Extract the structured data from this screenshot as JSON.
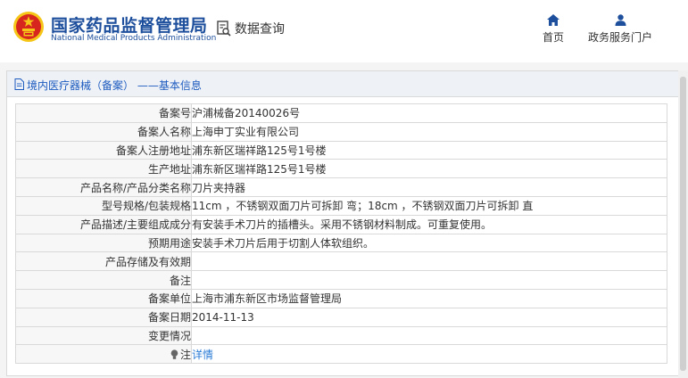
{
  "header": {
    "site_title": "国家药品监督管理局",
    "site_subtitle": "National Medical Products Administration",
    "data_query_label": "数据查询",
    "nav": [
      {
        "label": "首页",
        "icon": "home-icon"
      },
      {
        "label": "政务服务门户",
        "icon": "user-icon"
      }
    ]
  },
  "panel": {
    "title": "境内医疗器械（备案）  ——基本信息"
  },
  "rows": [
    {
      "label": "备案号",
      "value": "沪浦械备20140026号"
    },
    {
      "label": "备案人名称",
      "value": "上海申丁实业有限公司"
    },
    {
      "label": "备案人注册地址",
      "value": "浦东新区瑞祥路125号1号楼"
    },
    {
      "label": "生产地址",
      "value": "浦东新区瑞祥路125号1号楼"
    },
    {
      "label": "产品名称/产品分类名称",
      "value": "刀片夹持器"
    },
    {
      "label": "型号规格/包装规格",
      "value": "11cm ，不锈钢双面刀片可拆卸 弯；18cm ，不锈钢双面刀片可拆卸 直"
    },
    {
      "label": "产品描述/主要组成成分",
      "value": "有安装手术刀片的插槽头。采用不锈钢材料制成。可重复使用。"
    },
    {
      "label": "预期用途",
      "value": "安装手术刀片后用于切割人体软组织。"
    },
    {
      "label": "产品存储及有效期",
      "value": ""
    },
    {
      "label": "备注",
      "value": ""
    },
    {
      "label": "备案单位",
      "value": "上海市浦东新区市场监督管理局"
    },
    {
      "label": "备案日期",
      "value": "2014-11-13"
    },
    {
      "label": "变更情况",
      "value": ""
    },
    {
      "label": "注",
      "value": "详情"
    }
  ],
  "colors": {
    "brand_blue": "#1d4f9c",
    "link_blue": "#2a7bd6",
    "logo_red": "#d7261e",
    "logo_gold": "#f5c518"
  }
}
